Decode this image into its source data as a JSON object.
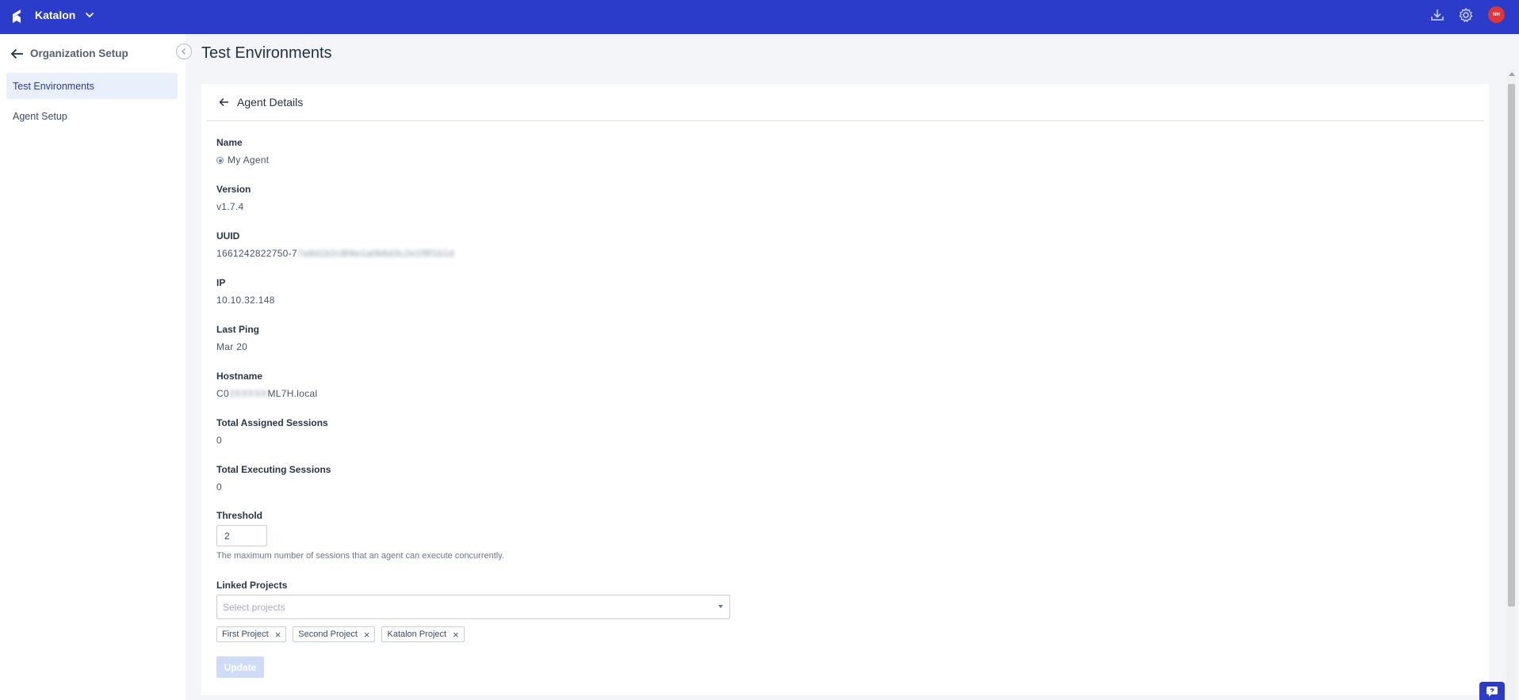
{
  "app": {
    "org_name": "Katalon",
    "avatar_initials": "NH",
    "brand_color": "#2b3bca"
  },
  "topbar_icons": [
    "download-icon",
    "gear-icon"
  ],
  "sidebar": {
    "back_label": "Organization Setup",
    "items": [
      {
        "label": "Test Environments",
        "active": true
      },
      {
        "label": "Agent Setup",
        "active": false
      }
    ]
  },
  "page": {
    "title": "Test Environments"
  },
  "agent": {
    "header": "Agent Details",
    "fields": {
      "name_label": "Name",
      "name_value": "My Agent",
      "version_label": "Version",
      "version_value": "v1.7.4",
      "uuid_label": "UUID",
      "uuid_prefix": "1661242822750-7",
      "uuid_redacted": "7a9d1b2c8f4e1a0b6d3c2e1f9f1b1d",
      "ip_label": "IP",
      "ip_value": "10.10.32.148",
      "last_ping_label": "Last Ping",
      "last_ping_value": "Mar 20",
      "hostname_label": "Hostname",
      "hostname_prefix": "C0",
      "hostname_redacted": "2XXXXX",
      "hostname_suffix": "ML7H.local",
      "assigned_label": "Total Assigned Sessions",
      "assigned_value": "0",
      "executing_label": "Total Executing Sessions",
      "executing_value": "0",
      "threshold_label": "Threshold",
      "threshold_value": "2",
      "threshold_hint": "The maximum number of sessions that an agent can execute concurrently.",
      "linked_label": "Linked Projects",
      "linked_placeholder": "Select projects"
    },
    "linked_projects": [
      "First Project",
      "Second Project",
      "Katalon Project"
    ],
    "update_label": "Update"
  }
}
